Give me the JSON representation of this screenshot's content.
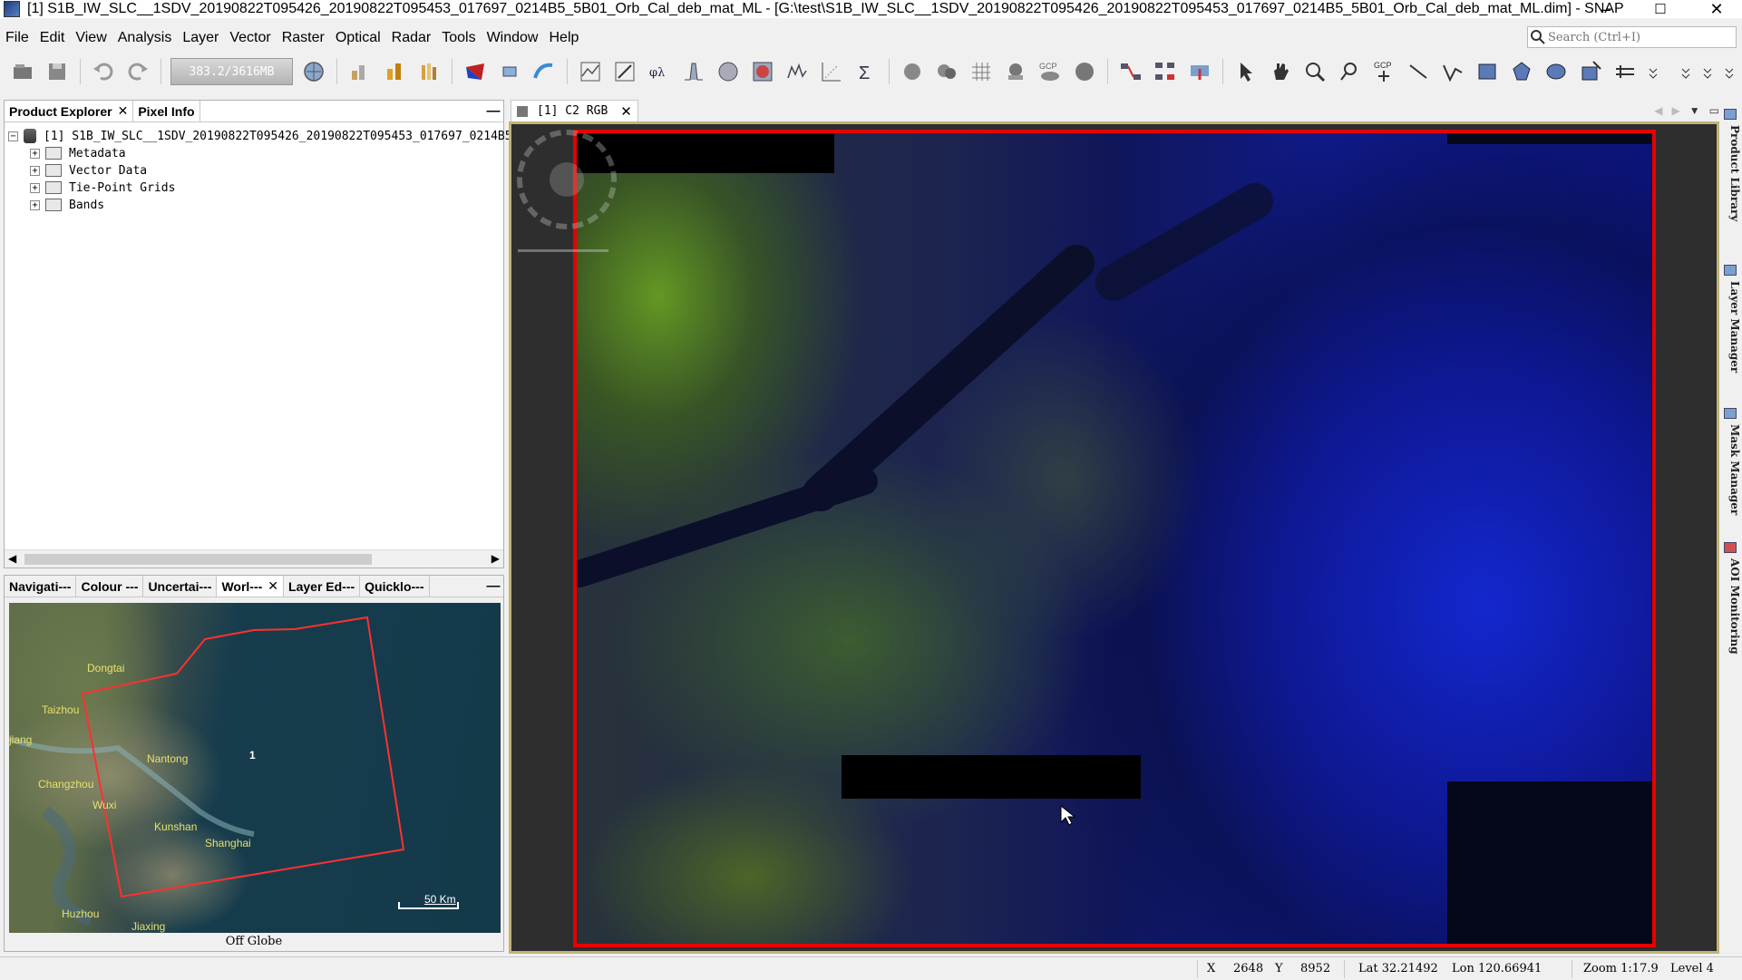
{
  "window": {
    "title": "[1] S1B_IW_SLC__1SDV_20190822T095426_20190822T095453_017697_0214B5_5B01_Orb_Cal_deb_mat_ML - [G:\\test\\S1B_IW_SLC__1SDV_20190822T095426_20190822T095453_017697_0214B5_5B01_Orb_Cal_deb_mat_ML.dim] - SNAP",
    "minimize": "–",
    "maximize": "☐",
    "close": "✕"
  },
  "menu": [
    "File",
    "Edit",
    "View",
    "Analysis",
    "Layer",
    "Vector",
    "Raster",
    "Optical",
    "Radar",
    "Tools",
    "Window",
    "Help"
  ],
  "search": {
    "placeholder": "Search (Ctrl+I)"
  },
  "toolbar": {
    "memory": "383.2/3616MB",
    "gcp_label": "GCP"
  },
  "product_explorer": {
    "tabs": [
      {
        "label": "Product Explorer",
        "closable": true
      },
      {
        "label": "Pixel Info",
        "closable": false
      }
    ],
    "root": "[1] S1B_IW_SLC__1SDV_20190822T095426_20190822T095453_017697_0214B5",
    "nodes": [
      "Metadata",
      "Vector Data",
      "Tie-Point Grids",
      "Bands"
    ]
  },
  "tool_panel": {
    "tabs": [
      "Navigati---",
      "Colour ---",
      "Uncertai---",
      "Worl---",
      "Layer Ed---",
      "Quicklo---"
    ],
    "map_labels": [
      "Dongtai",
      "Taizhou",
      "jiang",
      "Nantong",
      "Changzhou",
      "Wuxi",
      "Kunshan",
      "Shanghai",
      "Huzhou",
      "Jiaxing",
      "1"
    ],
    "scale": "50 Km",
    "footer": "Off Globe"
  },
  "image_view": {
    "tab": "[1] C2 RGB"
  },
  "side_panels": [
    "Product Library",
    "Layer Manager",
    "Mask Manager",
    "AOI Monitoring"
  ],
  "status": {
    "x_label": "X",
    "x_value": "2648",
    "y_label": "Y",
    "y_value": "8952",
    "lat": "Lat 32.21492",
    "lon": "Lon 120.66941",
    "zoom": "Zoom 1:17.9",
    "level": "Level 4"
  },
  "colors": {
    "frame_border": "#c0b476",
    "image_outline": "#e80000",
    "footprint": "#ff3030"
  }
}
